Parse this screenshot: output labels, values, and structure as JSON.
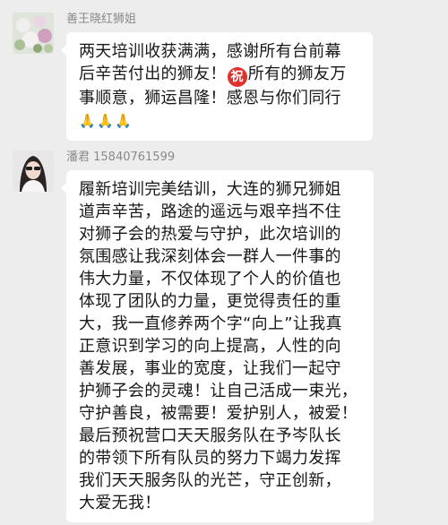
{
  "messages": [
    {
      "sender": "善王晓红狮姐",
      "lines": [
        "两天培训收获满满，感谢所有台前幕",
        "后辛苦付出的狮友！",
        "所有的狮友万",
        "事顺意，狮运昌隆！感恩与你们同行"
      ],
      "emoji_label": "祝",
      "pray_emoji": "🙏"
    },
    {
      "sender": "潘君 15840761599",
      "lines": [
        "履新培训完美结训，大连的狮兄狮姐",
        "道声辛苦，路途的遥远与艰辛挡不住",
        "对狮子会的热爱与守护，此次培训的",
        "氛围感让我深刻体会一群人一件事的",
        "伟大力量，不仅体现了个人的价值也",
        "体现了团队的力量，更觉得责任的重",
        "大，我一直修养两个字“向上”让我真",
        "正意识到学习的向上提高，人性的向",
        "善发展，事业的宽度，让我们一起守",
        "护狮子会的灵魂！让自己活成一束光，",
        "守护善良，被需要！爱护别人，被爱！",
        "最后预祝营口天天服务队在予岑队长",
        "的带领下所有队员的努力下竭力发挥",
        "我们天天服务队的光芒，守正创新，",
        "大爱无我！"
      ]
    }
  ]
}
